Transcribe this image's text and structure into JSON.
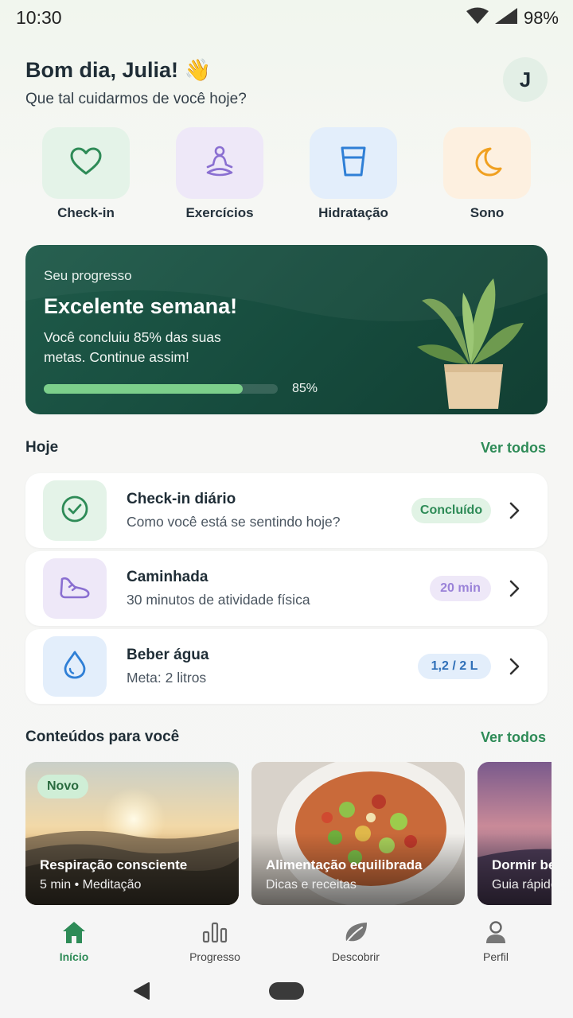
{
  "status": {
    "time": "10:30",
    "battery": "98%"
  },
  "header": {
    "greeting": "Bom dia, Julia! 👋",
    "subtitle": "Que tal cuidarmos de você hoje?",
    "avatar_initial": "J"
  },
  "quick_actions": [
    {
      "label": "Check-in",
      "icon": "heart-icon",
      "bg": "#e4f3e8",
      "color": "#2e8b57"
    },
    {
      "label": "Exercícios",
      "icon": "meditation-icon",
      "bg": "#eee8f8",
      "color": "#8a6fd1"
    },
    {
      "label": "Hidratação",
      "icon": "water-glass-icon",
      "bg": "#e3eefb",
      "color": "#2f7fd6"
    },
    {
      "label": "Sono",
      "icon": "moon-icon",
      "bg": "#fdf0e0",
      "color": "#f0a020"
    }
  ],
  "progress_card": {
    "label": "Seu progresso",
    "title": "Excelente semana!",
    "description": "Você concluiu 85% das suas metas. Continue assim!",
    "percent_label": "85%",
    "progress": 0.85
  },
  "today": {
    "title": "Hoje",
    "see_all": "Ver todos",
    "tasks": [
      {
        "title": "Check-in diário",
        "subtitle": "Como você está se sentindo hoje?",
        "badge": "Concluído",
        "icon": "check-circle-icon"
      },
      {
        "title": "Caminhada",
        "subtitle": "30 minutos de atividade física",
        "badge": "20 min",
        "icon": "sneaker-icon"
      },
      {
        "title": "Beber água",
        "subtitle": "Meta: 2 litros",
        "badge": "1,2 / 2 L",
        "icon": "water-drop-icon"
      }
    ]
  },
  "contents": {
    "title": "Conteúdos para você",
    "see_all": "Ver todos",
    "cards": [
      {
        "badge": "Novo",
        "title": "Respiração consciente",
        "subtitle": "5 min • Meditação"
      },
      {
        "title": "Alimentação equilibrada",
        "subtitle": "Dicas e receitas"
      },
      {
        "title": "Dormir bem",
        "subtitle": "Guia rápido"
      }
    ]
  },
  "bottom_nav": [
    {
      "label": "Início",
      "icon": "home-icon",
      "active": true
    },
    {
      "label": "Progresso",
      "icon": "bar-chart-icon",
      "active": false
    },
    {
      "label": "Descobrir",
      "icon": "leaf-icon",
      "active": false
    },
    {
      "label": "Perfil",
      "icon": "person-icon",
      "active": false
    }
  ],
  "colors": {
    "accent": "#2e8b57",
    "card_dark": "#1a5244"
  }
}
